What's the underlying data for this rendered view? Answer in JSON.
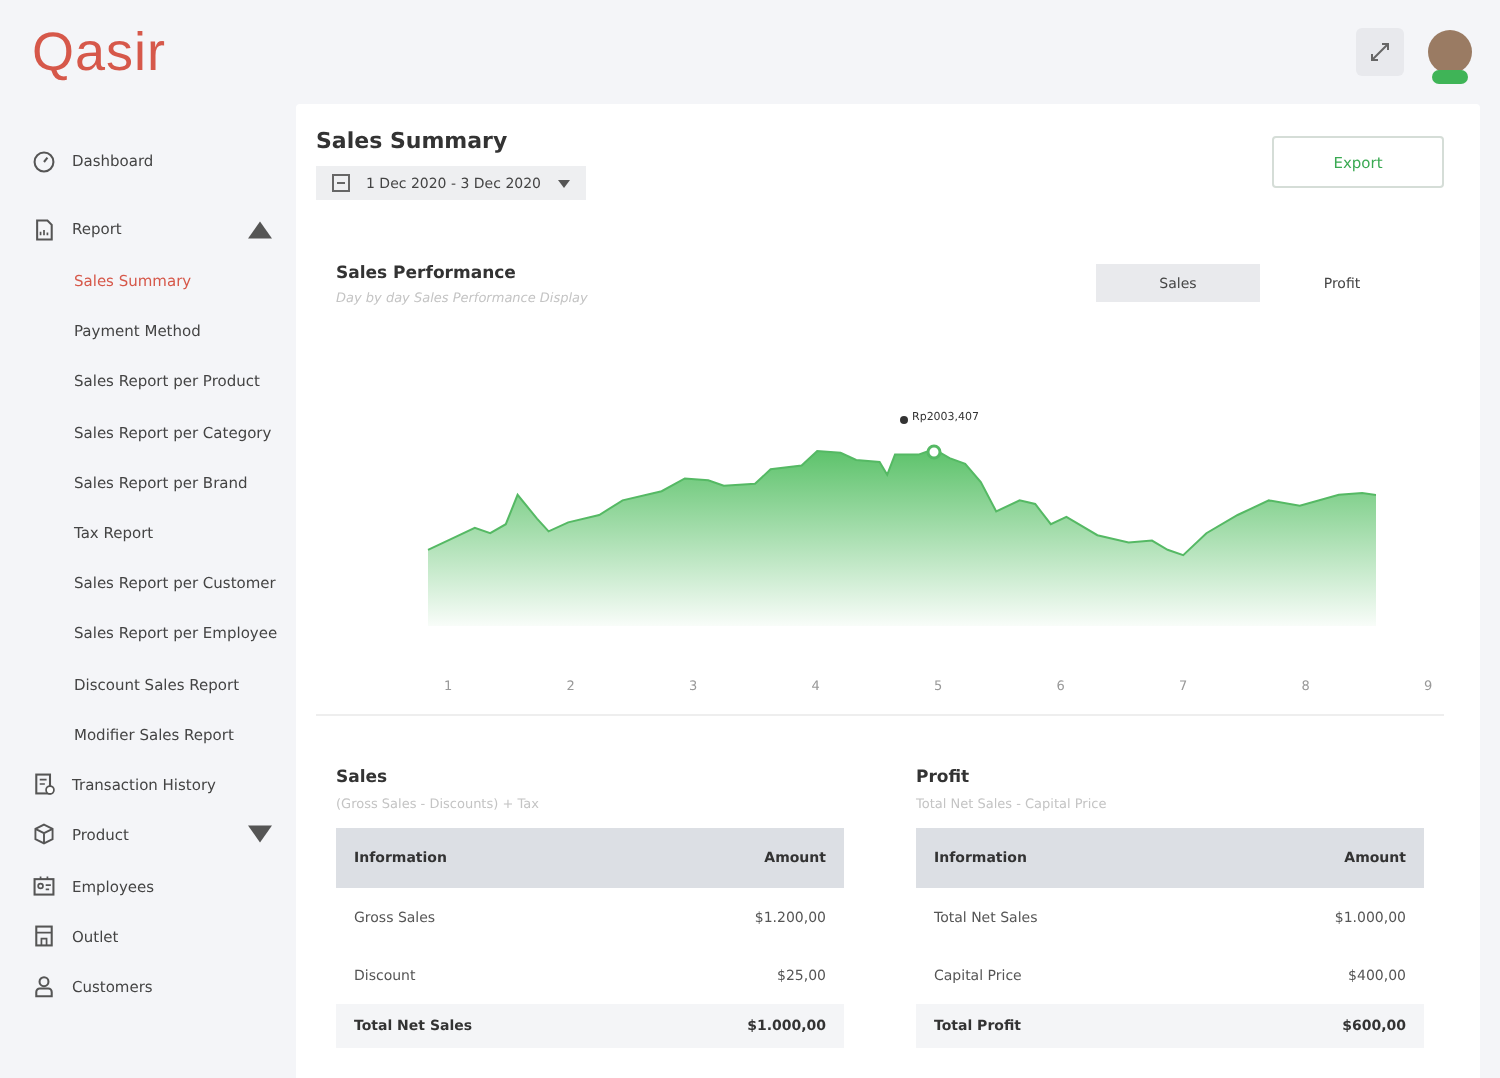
{
  "header": {
    "logo": "Qasir"
  },
  "sidebar": {
    "items": [
      {
        "kind": "link",
        "label": "Dashboard"
      },
      {
        "kind": "group",
        "label": "Report",
        "expanded": true,
        "children": [
          {
            "label": "Sales Summary",
            "selected": true
          },
          {
            "label": "Payment Method",
            "selected": false
          },
          {
            "label": "Sales Report per Product",
            "selected": false
          },
          {
            "label": "Sales Report per Category",
            "selected": false
          },
          {
            "label": "Sales Report per Brand",
            "selected": false
          },
          {
            "label": "Tax Report",
            "selected": false
          },
          {
            "label": "Sales Report per Customer",
            "selected": false
          },
          {
            "label": "Sales Report per Employee",
            "selected": false
          },
          {
            "label": "Discount Sales Report",
            "selected": false
          },
          {
            "label": "Modifier Sales Report",
            "selected": false
          }
        ]
      },
      {
        "kind": "link",
        "label": "Transaction History"
      },
      {
        "kind": "group",
        "label": "Product",
        "expanded": false
      },
      {
        "kind": "link",
        "label": "Employees"
      },
      {
        "kind": "link",
        "label": "Outlet"
      },
      {
        "kind": "link",
        "label": "Customers"
      }
    ]
  },
  "page": {
    "title": "Sales Summary",
    "date_range": "1 Dec 2020 - 3 Dec 2020",
    "export_button": "Export"
  },
  "performance": {
    "title": "Sales Performance",
    "subtitle": "Day by day Sales Performance Display",
    "tabs": [
      {
        "label": "Sales",
        "selected": true
      },
      {
        "label": "Profit",
        "selected": false
      }
    ],
    "tooltip": "Rp2003,407",
    "x_labels": [
      "1",
      "2",
      "3",
      "4",
      "5",
      "6",
      "7",
      "8",
      "9"
    ]
  },
  "tables": [
    {
      "title": "Sales",
      "formula": "(Gross Sales - Discounts) + Tax",
      "columns": [
        "Information",
        "Amount"
      ],
      "rows": [
        {
          "kind": "item",
          "label": "Gross Sales",
          "amount": "$1.200,00"
        },
        {
          "kind": "item",
          "label": "Discount",
          "amount": "$25,00"
        },
        {
          "kind": "total",
          "label": "Total Net Sales",
          "amount": "$1.000,00"
        }
      ]
    },
    {
      "title": "Profit",
      "formula": "Total Net Sales - Capital Price",
      "columns": [
        "Information",
        "Amount"
      ],
      "rows": [
        {
          "kind": "item",
          "label": "Total Net Sales",
          "amount": "$1.000,00"
        },
        {
          "kind": "item",
          "label": "Capital Price",
          "amount": "$400,00"
        },
        {
          "kind": "total",
          "label": "Total Profit",
          "amount": "$600,00"
        }
      ]
    }
  ]
}
